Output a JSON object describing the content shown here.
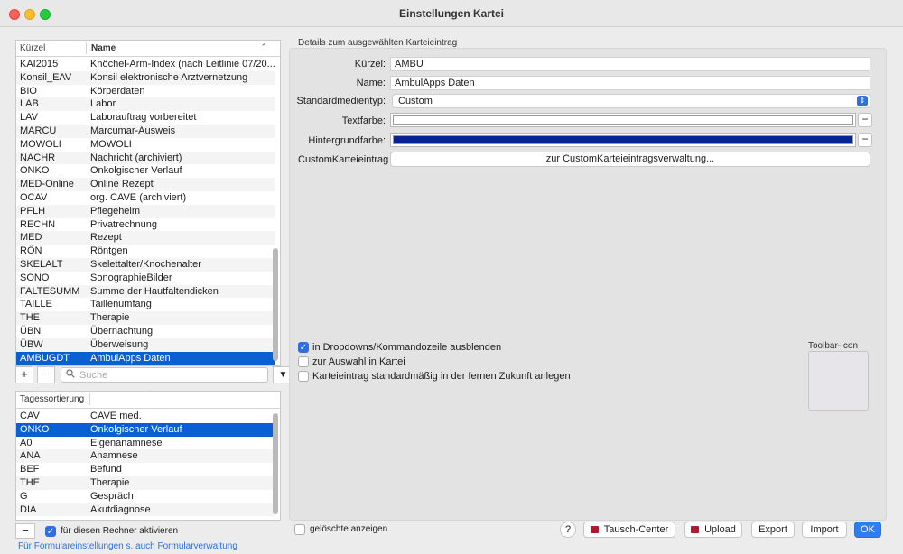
{
  "window": {
    "title": "Einstellungen Kartei"
  },
  "list": {
    "col_kuerzel": "Kürzel",
    "col_name": "Name",
    "sort_indicator": "⌃",
    "rows": [
      {
        "k": "KAI2015",
        "n": "Knöchel-Arm-Index (nach Leitlinie 07/20..."
      },
      {
        "k": "Konsil_EAV",
        "n": "Konsil elektronische Arztvernetzung"
      },
      {
        "k": "BIO",
        "n": "Körperdaten"
      },
      {
        "k": "LAB",
        "n": "Labor"
      },
      {
        "k": "LAV",
        "n": "Laborauftrag vorbereitet"
      },
      {
        "k": "MARCU",
        "n": "Marcumar-Ausweis"
      },
      {
        "k": "MOWOLI",
        "n": "MOWOLI"
      },
      {
        "k": "NACHR",
        "n": "Nachricht (archiviert)"
      },
      {
        "k": "ONKO",
        "n": "Onkolgischer Verlauf"
      },
      {
        "k": "MED-Online",
        "n": "Online Rezept"
      },
      {
        "k": "OCAV",
        "n": "org. CAVE (archiviert)"
      },
      {
        "k": "PFLH",
        "n": "Pflegeheim"
      },
      {
        "k": "RECHN",
        "n": "Privatrechnung"
      },
      {
        "k": "MED",
        "n": "Rezept"
      },
      {
        "k": "RÖN",
        "n": "Röntgen"
      },
      {
        "k": "SKELALT",
        "n": "Skelettalter/Knochenalter"
      },
      {
        "k": "SONO",
        "n": "SonographieBilder"
      },
      {
        "k": "FALTESUMM",
        "n": "Summe der Hautfaltendicken"
      },
      {
        "k": "TAILLE",
        "n": "Taillenumfang"
      },
      {
        "k": "THE",
        "n": "Therapie"
      },
      {
        "k": "ÜBN",
        "n": "Übernachtung"
      },
      {
        "k": "ÜBW",
        "n": "Überweisung"
      },
      {
        "k": "AMBUGDT",
        "n": "AmbulApps Daten",
        "selected": true
      }
    ],
    "add_label": "+",
    "remove_label": "−",
    "search_placeholder": "Suche",
    "dropdown_label": "▼"
  },
  "day_sort": {
    "header": "Tagessortierung",
    "rows": [
      {
        "k": "CAV",
        "n": "CAVE med."
      },
      {
        "k": "ONKO",
        "n": "Onkolgischer Verlauf",
        "selected": true
      },
      {
        "k": "A0",
        "n": "Eigenanamnese"
      },
      {
        "k": "ANA",
        "n": "Anamnese"
      },
      {
        "k": "BEF",
        "n": "Befund"
      },
      {
        "k": "THE",
        "n": "Therapie"
      },
      {
        "k": "G",
        "n": "Gespräch"
      },
      {
        "k": "DIA",
        "n": "Akutdiagnose"
      }
    ],
    "remove_label": "−",
    "activate_label": "für diesen Rechner aktivieren",
    "activate_checked": true
  },
  "footer_link": "Für Formulareinstellungen s. auch Formularverwaltung",
  "details": {
    "group_title": "Details zum ausgewählten Karteieintrag",
    "kuerzel_label": "Kürzel:",
    "kuerzel_value": "AMBU",
    "name_label": "Name:",
    "name_value": "AmbulApps Daten",
    "medientyp_label": "Standardmedientyp:",
    "medientyp_value": "Custom",
    "textfarbe_label": "Textfarbe:",
    "textfarbe_color": "#ffffff",
    "hintergrund_label": "Hintergrundfarbe:",
    "hintergrund_color": "#06238f",
    "custom_label": "CustomKarteieintrag",
    "custom_button": "zur CustomKarteieintragsverwaltung...",
    "color_minus": "−",
    "cb_hide_label": "in Dropdowns/Kommandozeile ausblenden",
    "cb_hide_checked": true,
    "cb_select_label": "zur Auswahl in Kartei",
    "cb_select_checked": false,
    "cb_future_label": "Karteieintrag standardmäßig in der fernen Zukunft anlegen",
    "cb_future_checked": false,
    "toolbar_icon_label": "Toolbar-Icon"
  },
  "bottom": {
    "show_deleted_label": "gelöschte anzeigen",
    "show_deleted_checked": false,
    "help": "?",
    "tausch_center": "Tausch-Center",
    "upload": "Upload",
    "export": "Export",
    "import": "Import",
    "ok": "OK"
  }
}
